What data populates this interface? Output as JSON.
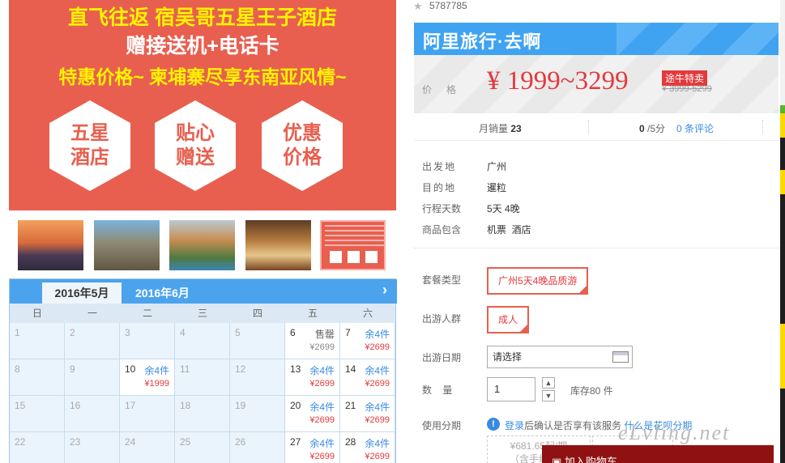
{
  "banner": {
    "line1": "直飞往返 宿吴哥五星王子酒店",
    "line2": "赠接送机+电话卡",
    "line3": "特惠价格~ 柬埔寨尽享东南亚风情~",
    "hexes": [
      {
        "top": "五星",
        "bottom": "酒店"
      },
      {
        "top": "贴心",
        "bottom": "赠送"
      },
      {
        "top": "优惠",
        "bottom": "价格"
      }
    ]
  },
  "calendar": {
    "month_active": "2016年5月",
    "month_next": "2016年6月",
    "next_icon": "chevron-right-icon",
    "weekdays": [
      "日",
      "一",
      "二",
      "三",
      "四",
      "五",
      "六"
    ],
    "rows": [
      [
        {
          "d": "1"
        },
        {
          "d": "2"
        },
        {
          "d": "3"
        },
        {
          "d": "4"
        },
        {
          "d": "5"
        },
        {
          "d": "6",
          "st": "售罄",
          "pr": "¥2699",
          "sold": true
        },
        {
          "d": "7",
          "st": "余4件",
          "pr": "¥2699"
        }
      ],
      [
        {
          "d": "8"
        },
        {
          "d": "9"
        },
        {
          "d": "10",
          "st": "余4件",
          "pr": "¥1999"
        },
        {
          "d": "11"
        },
        {
          "d": "12"
        },
        {
          "d": "13",
          "st": "余4件",
          "pr": "¥2699"
        },
        {
          "d": "14",
          "st": "余4件",
          "pr": "¥2699"
        }
      ],
      [
        {
          "d": "15"
        },
        {
          "d": "16"
        },
        {
          "d": "17"
        },
        {
          "d": "18"
        },
        {
          "d": "19"
        },
        {
          "d": "20",
          "st": "余4件",
          "pr": "¥2699"
        },
        {
          "d": "21",
          "st": "余4件",
          "pr": "¥2699"
        }
      ],
      [
        {
          "d": "22"
        },
        {
          "d": "23"
        },
        {
          "d": "24"
        },
        {
          "d": "25"
        },
        {
          "d": "26"
        },
        {
          "d": "27",
          "st": "余4件",
          "pr": "¥2699"
        },
        {
          "d": "28",
          "st": "余4件",
          "pr": "¥2699"
        }
      ]
    ]
  },
  "product": {
    "id": "5787785",
    "brand": "阿里旅行·去啊",
    "price_label": "价格",
    "price": "¥ 1999~3299",
    "tag": "途牛特卖",
    "orig_price": "¥ 3999-5299",
    "monthly_sales_label": "月销量",
    "monthly_sales": "23",
    "rating": "0",
    "rating_suffix": "/5分",
    "reviews": "0 条评论"
  },
  "details": [
    {
      "label": "出发地",
      "value": "广州"
    },
    {
      "label": "目的地",
      "value": "暹粒"
    },
    {
      "label": "行程天数",
      "value": "5天 4晚"
    },
    {
      "label": "商品包含",
      "value": "机票  酒店"
    }
  ],
  "form": {
    "package_label": "套餐类型",
    "package_value": "广州5天4晚品质游",
    "crowd_label": "出游人群",
    "crowd_value": "成人",
    "date_label": "出游日期",
    "date_placeholder": "请选择",
    "qty_label": "数    量",
    "qty_value": "1",
    "stock": "库存80 件",
    "installment_label": "使用分期",
    "login_text": "登录",
    "login_rest": "后确认是否享有该服务",
    "huabei_link": "什么是花呗分期",
    "inst_price": "¥681.65起/期",
    "inst_fee": "（含手续费）",
    "cart_button": "加入购物车",
    "watermark": "eLvling.net"
  },
  "colors": {
    "accent_blue": "#3fa3f2",
    "price_red": "#e4393c",
    "banner_red": "#e85f4f"
  }
}
